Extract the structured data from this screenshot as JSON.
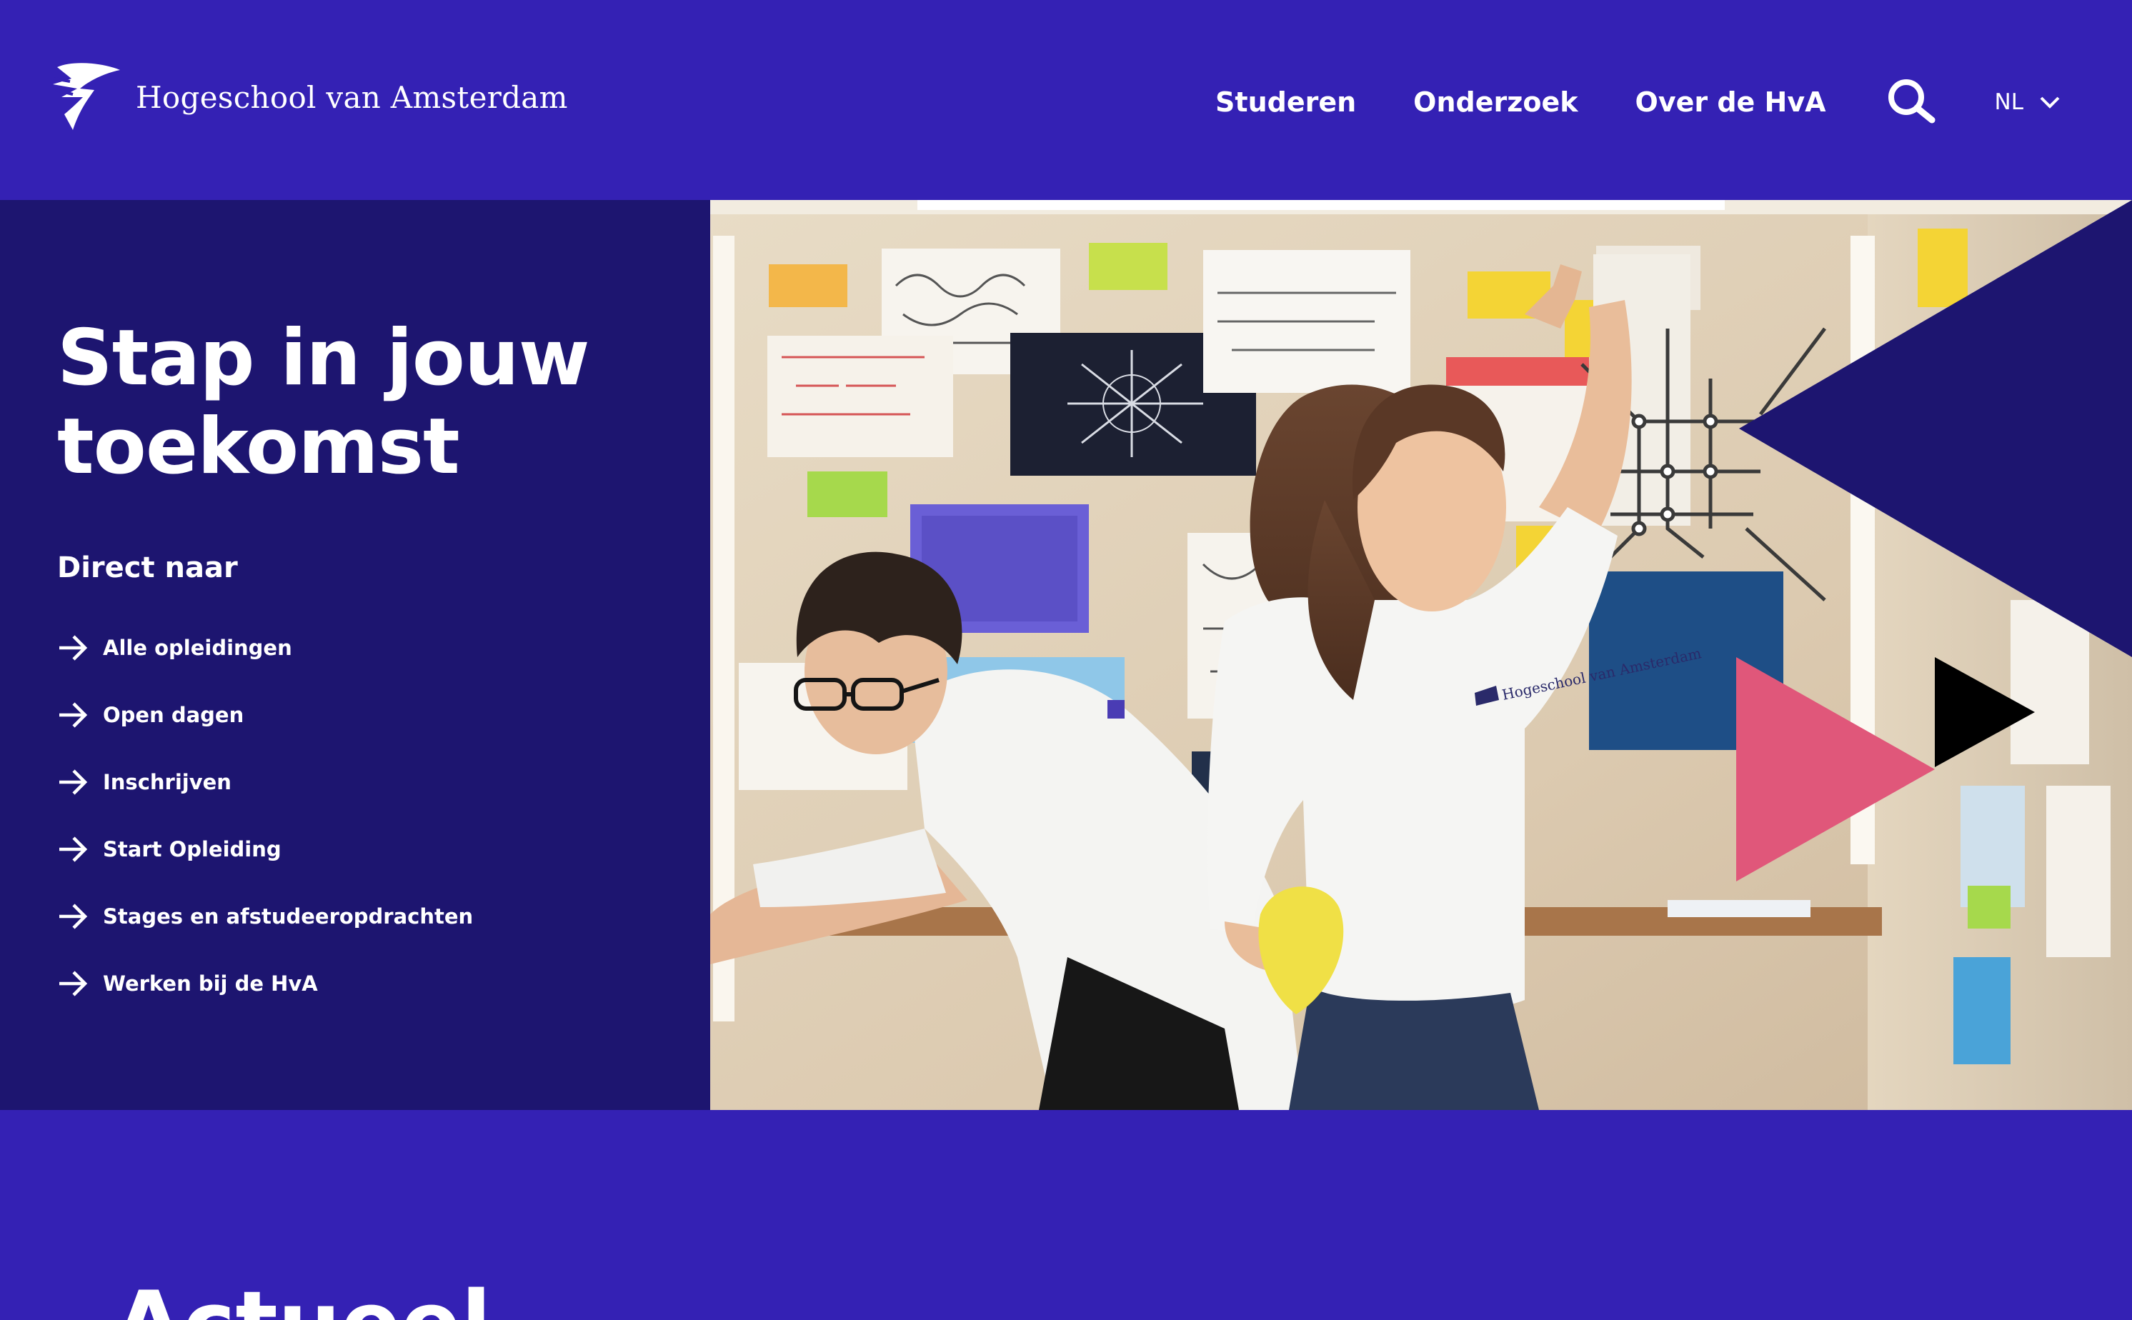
{
  "brand": {
    "name": "Hogeschool van Amsterdam",
    "logo_icon": "hva-logo-icon",
    "primary_color": "#3421b4",
    "panel_color": "#1d1570"
  },
  "nav": {
    "items": [
      {
        "label": "Studeren"
      },
      {
        "label": "Onderzoek"
      },
      {
        "label": "Over de HvA"
      }
    ],
    "search_icon": "search-icon",
    "language": {
      "label": "NL",
      "icon": "chevron-down-icon"
    }
  },
  "hero": {
    "title": "Stap in jouw toekomst",
    "quick_links_heading": "Direct naar",
    "quick_links": [
      {
        "label": "Alle opleidingen",
        "icon": "arrow-right-icon"
      },
      {
        "label": "Open dagen",
        "icon": "arrow-right-icon"
      },
      {
        "label": "Inschrijven",
        "icon": "arrow-right-icon"
      },
      {
        "label": "Start Opleiding",
        "icon": "arrow-right-icon"
      },
      {
        "label": "Stages en afstudeeropdrachten",
        "icon": "arrow-right-icon"
      },
      {
        "label": "Werken bij de HvA",
        "icon": "arrow-right-icon"
      }
    ],
    "image": {
      "shirt_print": "Hogeschool van Amsterdam",
      "accent_colors": [
        "#1d1570",
        "#e0577a",
        "#000000"
      ]
    }
  },
  "news": {
    "title": "Actueel"
  }
}
